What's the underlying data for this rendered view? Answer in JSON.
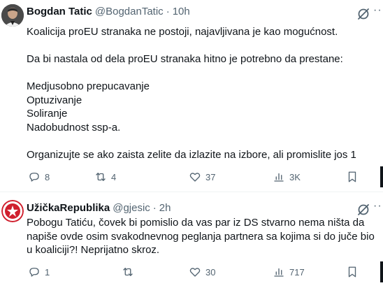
{
  "tweet1": {
    "name": "Bogdan Tatic",
    "handle": "@BogdanTatic",
    "dot": "·",
    "time": "10h",
    "more": "···",
    "lines": [
      "Koalicija proEU stranaka ne postoji, najavljivana je kao mogućnost.",
      "",
      "Da bi nastala od dela proEU stranaka hitno je potrebno da prestane:",
      "",
      "Medjusobno prepucavanje",
      "Optuzivanje",
      "Soliranje",
      "Nadobudnost ssp-a.",
      "",
      "Organizujte se ako zaista zelite da izlazite na izbore, ali promislite jos 1"
    ],
    "replies": "8",
    "reposts": "4",
    "likes": "37",
    "views": "3K",
    "icons": [
      "reply-icon",
      "repost-icon",
      "like-icon",
      "views-icon",
      "bookmark-icon"
    ]
  },
  "tweet2": {
    "name": "UžičkaRepublika",
    "handle": "@gjesic",
    "dot": "·",
    "time": "2h",
    "more": "···",
    "lines": [
      "Pobogu Tatiću, čovek bi pomislio da vas par iz DS stvarno nema ništa da",
      "napiše ovde osim svakodnevnog peglanja partnera sa kojima si do juče bio",
      "u koaliciji?!  Neprijatno skroz."
    ],
    "replies": "1",
    "reposts": "",
    "likes": "30",
    "views": "717",
    "icons": [
      "reply-icon",
      "repost-icon",
      "like-icon",
      "views-icon",
      "bookmark-icon"
    ]
  },
  "colors": {
    "text": "#0f1419",
    "muted": "#536471",
    "divider": "#eff3f4",
    "avatar_red": "#d0202e"
  }
}
